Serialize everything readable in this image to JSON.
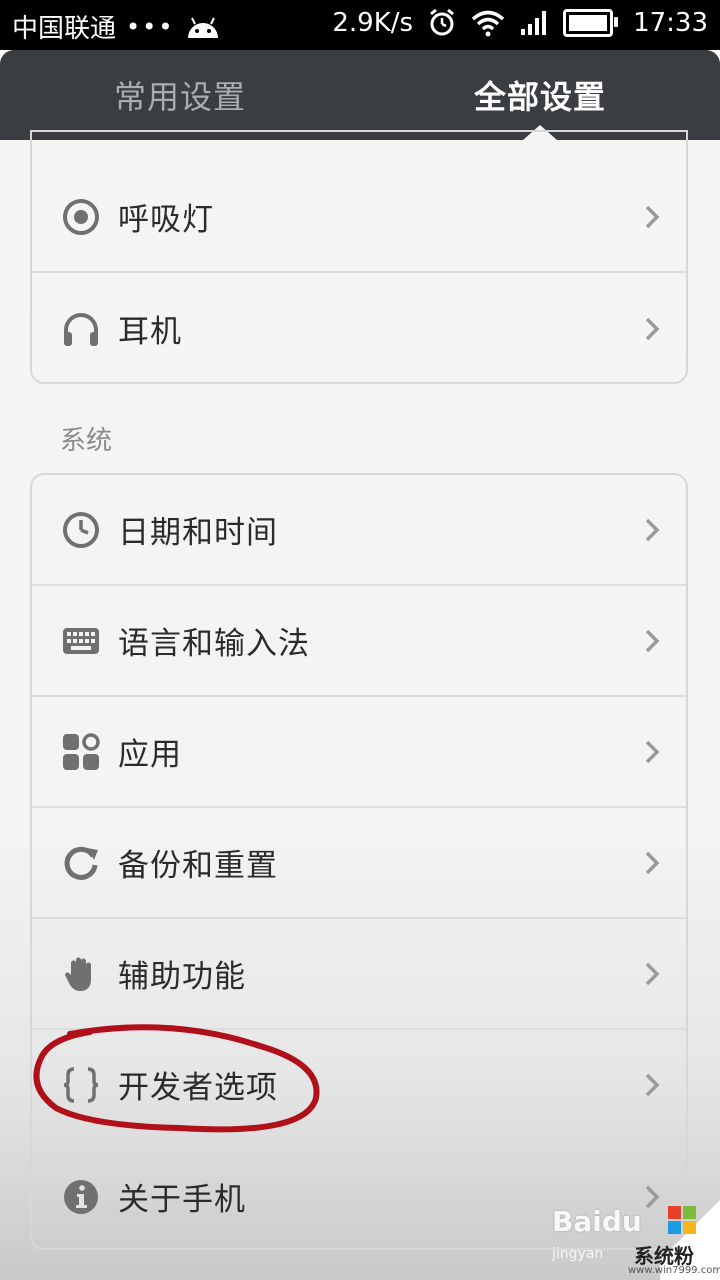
{
  "status_bar": {
    "carrier": "中国联通",
    "dots": "•••",
    "speed": "2.9K/s",
    "time": "17:33"
  },
  "tabs": [
    {
      "label": "常用设置",
      "active": false
    },
    {
      "label": "全部设置",
      "active": true
    }
  ],
  "top_items": [
    {
      "label": "呼吸灯",
      "icon": "breathing-light-icon"
    },
    {
      "label": "耳机",
      "icon": "headphones-icon"
    }
  ],
  "section": {
    "label": "系统"
  },
  "system_items": [
    {
      "label": "日期和时间",
      "icon": "clock-icon"
    },
    {
      "label": "语言和输入法",
      "icon": "keyboard-icon"
    },
    {
      "label": "应用",
      "icon": "apps-icon"
    },
    {
      "label": "备份和重置",
      "icon": "refresh-icon"
    },
    {
      "label": "辅助功能",
      "icon": "hand-icon"
    },
    {
      "label": "开发者选项",
      "icon": "braces-icon"
    },
    {
      "label": "关于手机",
      "icon": "info-icon"
    }
  ],
  "watermark": {
    "baidu": "Baidu",
    "baidu_sub": "jingyan",
    "site": "系统粉",
    "site_url": "www.win7999.com"
  },
  "colors": {
    "header_bg": "#3a3d42",
    "annotation": "#b0101a",
    "icon_gray": "#6f6f6f"
  }
}
